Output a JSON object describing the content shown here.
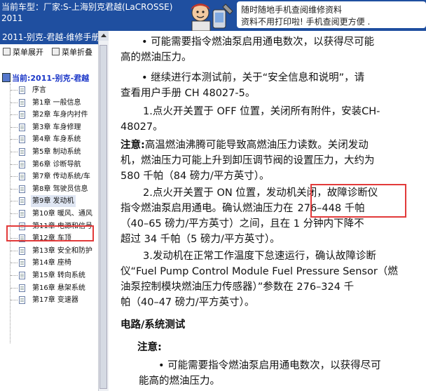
{
  "header": {
    "title_line1": "当前车型：厂家:S-上海别克君越(LaCROSSE)",
    "title_line2": "2011",
    "ad_line1": "随时随地手机查阅维修资料",
    "ad_line2": "资料不用打印啦! 手机查阅更方便 ."
  },
  "sidebar": {
    "title": "2011-别克-君越-维修手册",
    "expand_label": "菜单展开",
    "collapse_label": "菜单折叠",
    "root_label": "当前:2011-别克-君越",
    "items": [
      {
        "label": "序言"
      },
      {
        "label": "第1章 一般信息"
      },
      {
        "label": "第2章 车身内衬件"
      },
      {
        "label": "第3章 车身修理"
      },
      {
        "label": "第4章 车身系统"
      },
      {
        "label": "第5章 制动系统"
      },
      {
        "label": "第6章 诊断导航"
      },
      {
        "label": "第7章 传动系统/车"
      },
      {
        "label": "第8章 驾驶员信息"
      },
      {
        "label": "第9章 发动机"
      },
      {
        "label": "第10章 暖风、通风"
      },
      {
        "label": "第11章 电源和信号"
      },
      {
        "label": "第12章 车顶"
      },
      {
        "label": "第13章 安全和防护"
      },
      {
        "label": "第14章 座椅"
      },
      {
        "label": "第15章 转向系统"
      },
      {
        "label": "第16章 悬架系统"
      },
      {
        "label": "第17章 变速器"
      }
    ]
  },
  "content": {
    "bullet1_l1": "• 可能需要指令燃油泵启用通电数次，以获得尽可能",
    "bullet1_l2": "高的燃油压力。",
    "bullet2_l1": "• 继续进行本测试前，关于“安全信息和说明”，请",
    "bullet2_l2": "查看用户手册 CH   48027-5。",
    "step1_l1": "1.点火开关置于 OFF 位置，关闭所有附件，安装CH-",
    "step1_l2": "48027。",
    "note_label": "注意:",
    "note_l1": "高温燃油沸腾可能导致高燃油压力读数。关闭发动",
    "note_l2": "机，燃油压力可能上升到卸压调节阀的设置压力，大约为",
    "note_l3": "580   千帕（84   磅力/平方英寸）。",
    "step2_l1": "2.点火开关置于 ON 位置，发动机关闭，故障诊断仪",
    "step2_l2a": "指令燃油泵启用通电。确认燃油压力在",
    "step2_l2b": "276–448   千帕",
    "step2_l3": "（40–65   磅力/平方英寸）之间，且在 1   分钟内下降不",
    "step2_l4": "超过 34   千帕（5   磅力/平方英寸）。",
    "step3_l1": "3.发动机在正常工作温度下怠速运行，确认故障诊断",
    "step3_l2": "仪“Fuel Pump Control Module Fuel Pressure Sensor（燃",
    "step3_l3": "油泵控制模块燃油压力传感器）”参数在 276–324   千",
    "step3_l4": "帕（40–47   磅力/平方英寸）。",
    "section_title": "电路/系统测试",
    "note2_label": "注意:",
    "bullet3_l1": "• 可能需要指令燃油泵启用通电数次，以获得尽可",
    "bullet3_l2": "能高的燃油压力。"
  },
  "colors": {
    "header_bg": "#1f4fa0",
    "highlight": "#e23a3a"
  }
}
